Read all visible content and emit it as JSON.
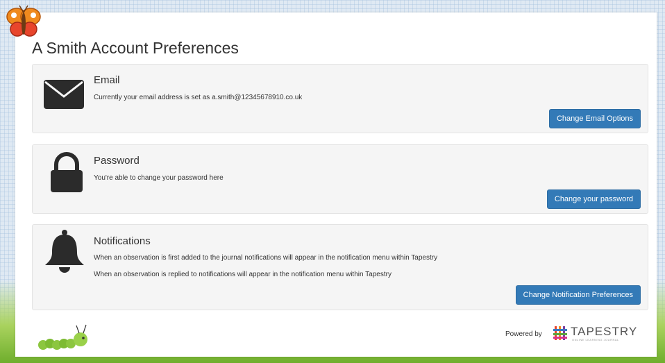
{
  "page": {
    "title": "A Smith Account Preferences"
  },
  "email": {
    "heading": "Email",
    "description": "Currently your email address is set as a.smith@12345678910.co.uk",
    "button_label": "Change Email Options",
    "icon": "envelope-icon"
  },
  "password": {
    "heading": "Password",
    "description": "You're able to change your password here",
    "button_label": "Change your password",
    "icon": "lock-icon"
  },
  "notifications": {
    "heading": "Notifications",
    "line1": "When an observation is first added to the journal notifications will appear in the notification menu within Tapestry",
    "line2": "When an observation is replied to notifications will appear in the notification menu within Tapestry",
    "button_label": "Change Notification Preferences",
    "icon": "bell-icon"
  },
  "footer": {
    "powered_by": "Powered by",
    "brand": "TAPESTRY",
    "tagline": "ONLINE LEARNING JOURNAL"
  },
  "colors": {
    "button": "#337ab7",
    "card_bg": "#f5f5f5",
    "icon": "#2b2b2b"
  }
}
